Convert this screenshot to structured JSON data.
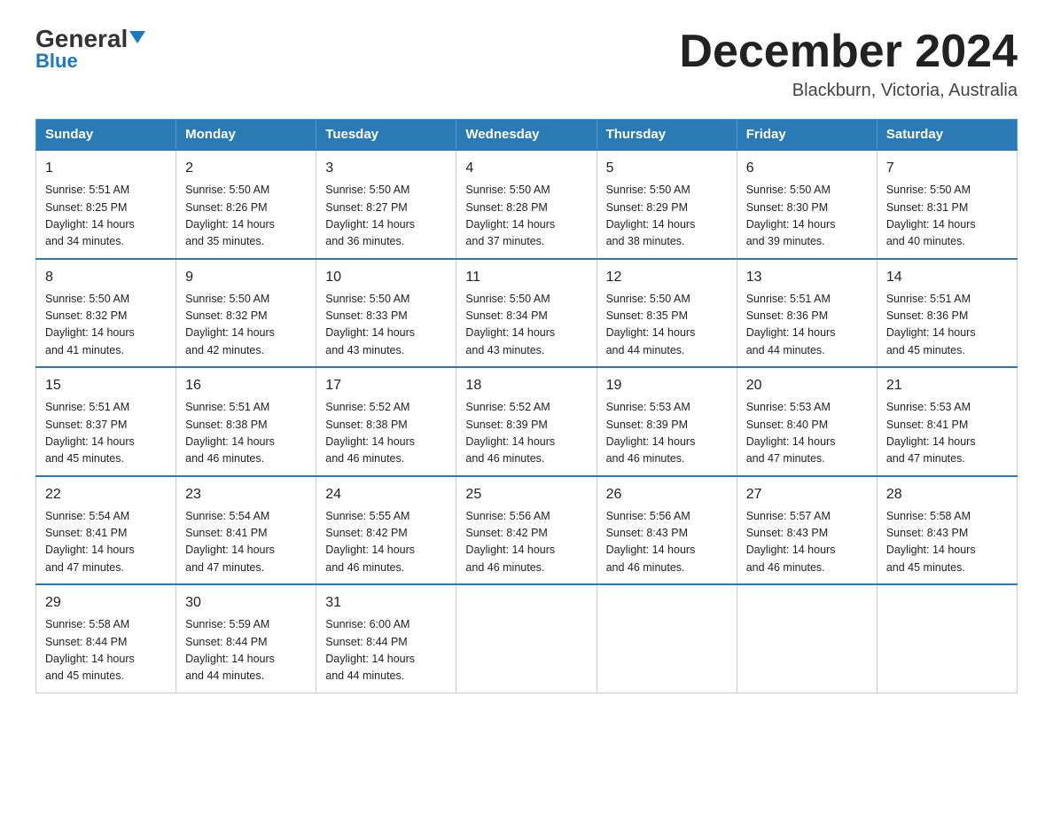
{
  "logo": {
    "general": "General",
    "triangle": "▶",
    "blue": "Blue"
  },
  "title": "December 2024",
  "subtitle": "Blackburn, Victoria, Australia",
  "weekdays": [
    "Sunday",
    "Monday",
    "Tuesday",
    "Wednesday",
    "Thursday",
    "Friday",
    "Saturday"
  ],
  "weeks": [
    [
      {
        "day": "1",
        "sunrise": "5:51 AM",
        "sunset": "8:25 PM",
        "daylight": "14 hours and 34 minutes."
      },
      {
        "day": "2",
        "sunrise": "5:50 AM",
        "sunset": "8:26 PM",
        "daylight": "14 hours and 35 minutes."
      },
      {
        "day": "3",
        "sunrise": "5:50 AM",
        "sunset": "8:27 PM",
        "daylight": "14 hours and 36 minutes."
      },
      {
        "day": "4",
        "sunrise": "5:50 AM",
        "sunset": "8:28 PM",
        "daylight": "14 hours and 37 minutes."
      },
      {
        "day": "5",
        "sunrise": "5:50 AM",
        "sunset": "8:29 PM",
        "daylight": "14 hours and 38 minutes."
      },
      {
        "day": "6",
        "sunrise": "5:50 AM",
        "sunset": "8:30 PM",
        "daylight": "14 hours and 39 minutes."
      },
      {
        "day": "7",
        "sunrise": "5:50 AM",
        "sunset": "8:31 PM",
        "daylight": "14 hours and 40 minutes."
      }
    ],
    [
      {
        "day": "8",
        "sunrise": "5:50 AM",
        "sunset": "8:32 PM",
        "daylight": "14 hours and 41 minutes."
      },
      {
        "day": "9",
        "sunrise": "5:50 AM",
        "sunset": "8:32 PM",
        "daylight": "14 hours and 42 minutes."
      },
      {
        "day": "10",
        "sunrise": "5:50 AM",
        "sunset": "8:33 PM",
        "daylight": "14 hours and 43 minutes."
      },
      {
        "day": "11",
        "sunrise": "5:50 AM",
        "sunset": "8:34 PM",
        "daylight": "14 hours and 43 minutes."
      },
      {
        "day": "12",
        "sunrise": "5:50 AM",
        "sunset": "8:35 PM",
        "daylight": "14 hours and 44 minutes."
      },
      {
        "day": "13",
        "sunrise": "5:51 AM",
        "sunset": "8:36 PM",
        "daylight": "14 hours and 44 minutes."
      },
      {
        "day": "14",
        "sunrise": "5:51 AM",
        "sunset": "8:36 PM",
        "daylight": "14 hours and 45 minutes."
      }
    ],
    [
      {
        "day": "15",
        "sunrise": "5:51 AM",
        "sunset": "8:37 PM",
        "daylight": "14 hours and 45 minutes."
      },
      {
        "day": "16",
        "sunrise": "5:51 AM",
        "sunset": "8:38 PM",
        "daylight": "14 hours and 46 minutes."
      },
      {
        "day": "17",
        "sunrise": "5:52 AM",
        "sunset": "8:38 PM",
        "daylight": "14 hours and 46 minutes."
      },
      {
        "day": "18",
        "sunrise": "5:52 AM",
        "sunset": "8:39 PM",
        "daylight": "14 hours and 46 minutes."
      },
      {
        "day": "19",
        "sunrise": "5:53 AM",
        "sunset": "8:39 PM",
        "daylight": "14 hours and 46 minutes."
      },
      {
        "day": "20",
        "sunrise": "5:53 AM",
        "sunset": "8:40 PM",
        "daylight": "14 hours and 47 minutes."
      },
      {
        "day": "21",
        "sunrise": "5:53 AM",
        "sunset": "8:41 PM",
        "daylight": "14 hours and 47 minutes."
      }
    ],
    [
      {
        "day": "22",
        "sunrise": "5:54 AM",
        "sunset": "8:41 PM",
        "daylight": "14 hours and 47 minutes."
      },
      {
        "day": "23",
        "sunrise": "5:54 AM",
        "sunset": "8:41 PM",
        "daylight": "14 hours and 47 minutes."
      },
      {
        "day": "24",
        "sunrise": "5:55 AM",
        "sunset": "8:42 PM",
        "daylight": "14 hours and 46 minutes."
      },
      {
        "day": "25",
        "sunrise": "5:56 AM",
        "sunset": "8:42 PM",
        "daylight": "14 hours and 46 minutes."
      },
      {
        "day": "26",
        "sunrise": "5:56 AM",
        "sunset": "8:43 PM",
        "daylight": "14 hours and 46 minutes."
      },
      {
        "day": "27",
        "sunrise": "5:57 AM",
        "sunset": "8:43 PM",
        "daylight": "14 hours and 46 minutes."
      },
      {
        "day": "28",
        "sunrise": "5:58 AM",
        "sunset": "8:43 PM",
        "daylight": "14 hours and 45 minutes."
      }
    ],
    [
      {
        "day": "29",
        "sunrise": "5:58 AM",
        "sunset": "8:44 PM",
        "daylight": "14 hours and 45 minutes."
      },
      {
        "day": "30",
        "sunrise": "5:59 AM",
        "sunset": "8:44 PM",
        "daylight": "14 hours and 44 minutes."
      },
      {
        "day": "31",
        "sunrise": "6:00 AM",
        "sunset": "8:44 PM",
        "daylight": "14 hours and 44 minutes."
      },
      null,
      null,
      null,
      null
    ]
  ],
  "labels": {
    "sunrise": "Sunrise:",
    "sunset": "Sunset:",
    "daylight": "Daylight:"
  }
}
